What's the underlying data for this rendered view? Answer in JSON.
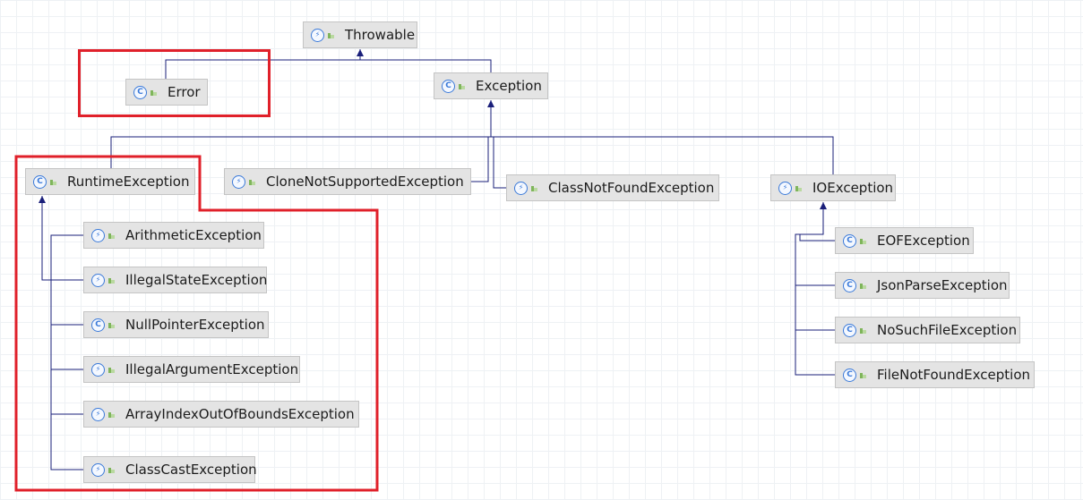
{
  "diagram": {
    "nodes": [
      {
        "id": "throwable",
        "label": "Throwable",
        "kind": "abstract"
      },
      {
        "id": "error",
        "label": "Error",
        "kind": "class"
      },
      {
        "id": "exception",
        "label": "Exception",
        "kind": "class"
      },
      {
        "id": "runtime",
        "label": "RuntimeException",
        "kind": "class"
      },
      {
        "id": "clonenotsupported",
        "label": "CloneNotSupportedException",
        "kind": "abstract"
      },
      {
        "id": "classnotfound",
        "label": "ClassNotFoundException",
        "kind": "abstract"
      },
      {
        "id": "ioexception",
        "label": "IOException",
        "kind": "abstract"
      },
      {
        "id": "arithmetic",
        "label": "ArithmeticException",
        "kind": "abstract"
      },
      {
        "id": "illegalstate",
        "label": "IllegalStateException",
        "kind": "abstract"
      },
      {
        "id": "nullpointer",
        "label": "NullPointerException",
        "kind": "class"
      },
      {
        "id": "illegalargument",
        "label": "IllegalArgumentException",
        "kind": "abstract"
      },
      {
        "id": "arrayindex",
        "label": "ArrayIndexOutOfBoundsException",
        "kind": "abstract"
      },
      {
        "id": "classcast",
        "label": "ClassCastException",
        "kind": "abstract"
      },
      {
        "id": "eof",
        "label": "EOFException",
        "kind": "class"
      },
      {
        "id": "jsonparse",
        "label": "JsonParseException",
        "kind": "class"
      },
      {
        "id": "nosuchfile",
        "label": "NoSuchFileException",
        "kind": "class"
      },
      {
        "id": "filenotfound",
        "label": "FileNotFoundException",
        "kind": "class"
      }
    ],
    "edges": [
      {
        "from": "error",
        "to": "throwable"
      },
      {
        "from": "exception",
        "to": "throwable"
      },
      {
        "from": "runtime",
        "to": "exception"
      },
      {
        "from": "clonenotsupported",
        "to": "exception"
      },
      {
        "from": "classnotfound",
        "to": "exception"
      },
      {
        "from": "ioexception",
        "to": "exception"
      },
      {
        "from": "arithmetic",
        "to": "runtime"
      },
      {
        "from": "illegalstate",
        "to": "runtime"
      },
      {
        "from": "nullpointer",
        "to": "runtime"
      },
      {
        "from": "illegalargument",
        "to": "runtime"
      },
      {
        "from": "arrayindex",
        "to": "runtime"
      },
      {
        "from": "classcast",
        "to": "runtime"
      },
      {
        "from": "eof",
        "to": "ioexception"
      },
      {
        "from": "jsonparse",
        "to": "ioexception"
      },
      {
        "from": "nosuchfile",
        "to": "ioexception"
      },
      {
        "from": "filenotfound",
        "to": "ioexception"
      }
    ],
    "icons": {
      "class": "class-icon",
      "abstract": "abstract-class-icon",
      "leaf": "leaf-icon"
    },
    "colors": {
      "edge": "#1a1f7a",
      "highlight": "#e0202a",
      "icon": "#3b7ad9"
    }
  }
}
